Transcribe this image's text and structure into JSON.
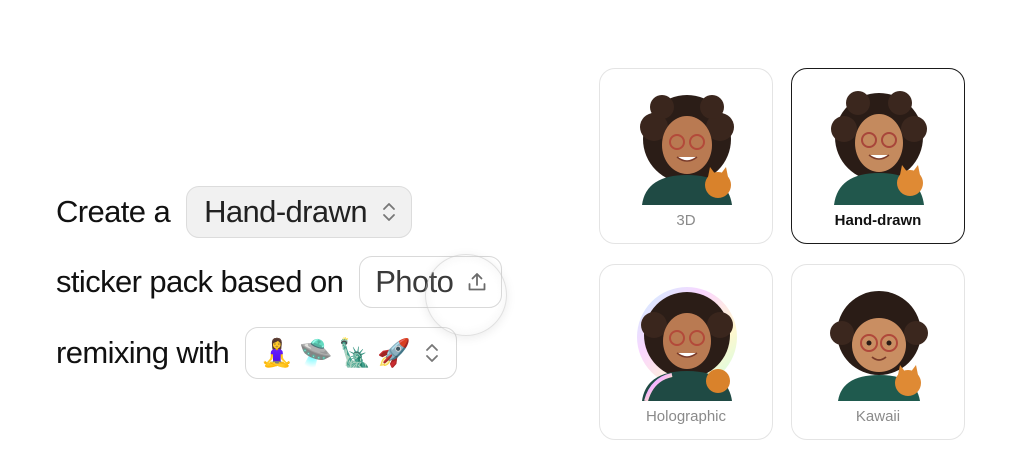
{
  "builder": {
    "line1_prefix": "Create a",
    "style_value": "Hand-drawn",
    "line2_prefix": "sticker pack based on",
    "source_value": "Photo",
    "line3_prefix": "remixing with",
    "remix_emojis": [
      "🧘‍♀️",
      "🛸",
      "🗽",
      "🚀"
    ]
  },
  "icons": {
    "chevron": "chevron-up-down-icon",
    "upload": "upload-icon"
  },
  "styles": [
    {
      "label": "3D",
      "selected": false
    },
    {
      "label": "Hand-drawn",
      "selected": true
    },
    {
      "label": "Holographic",
      "selected": false
    },
    {
      "label": "Kawaii",
      "selected": false
    }
  ],
  "colors": {
    "selected_border": "#1a1a1a",
    "chip_border": "#d9d9d9",
    "label_muted": "#8a8a8a"
  }
}
